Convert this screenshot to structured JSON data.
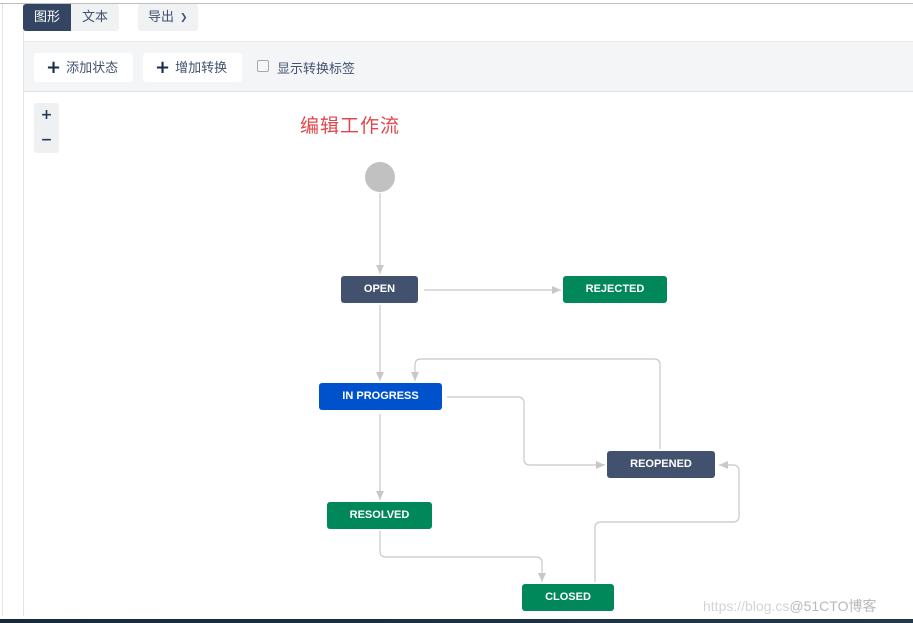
{
  "tabs": [
    {
      "label": "图形",
      "active": true
    },
    {
      "label": "文本",
      "active": false
    }
  ],
  "export": {
    "label": "导出",
    "icon": "chevron-down-icon"
  },
  "toolbar": {
    "add_state_label": "添加状态",
    "add_transition_label": "增加转换",
    "show_labels_label": "显示转换标签",
    "show_labels_checked": false
  },
  "zoom": {
    "in_label": "+",
    "out_label": "−"
  },
  "canvas": {
    "title": "编辑工作流"
  },
  "colors": {
    "todo": "#42526e",
    "in_progress": "#0052cc",
    "done": "#00875a",
    "start": "#c1c1c1",
    "edge": "#c8c8c8",
    "title": "#e0474c"
  },
  "workflow": {
    "start": {
      "id": "start"
    },
    "statuses": [
      {
        "id": "open",
        "label": "OPEN",
        "category": "todo"
      },
      {
        "id": "rejected",
        "label": "REJECTED",
        "category": "done"
      },
      {
        "id": "in_progress",
        "label": "IN PROGRESS",
        "category": "in_progress"
      },
      {
        "id": "reopened",
        "label": "REOPENED",
        "category": "todo"
      },
      {
        "id": "resolved",
        "label": "RESOLVED",
        "category": "done"
      },
      {
        "id": "closed",
        "label": "CLOSED",
        "category": "done"
      }
    ],
    "transitions": [
      {
        "from": "start",
        "to": "open"
      },
      {
        "from": "open",
        "to": "rejected"
      },
      {
        "from": "open",
        "to": "in_progress"
      },
      {
        "from": "in_progress",
        "to": "reopened"
      },
      {
        "from": "reopened",
        "to": "in_progress"
      },
      {
        "from": "in_progress",
        "to": "resolved"
      },
      {
        "from": "resolved",
        "to": "closed"
      },
      {
        "from": "closed",
        "to": "reopened"
      }
    ]
  },
  "watermark": {
    "text_faint": "https://blog.cs",
    "text_strong": "@51CTO博客"
  }
}
